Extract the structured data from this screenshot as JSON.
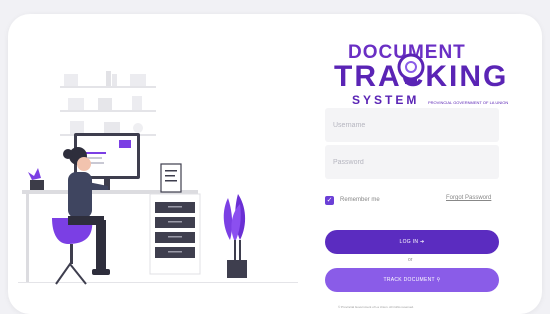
{
  "logo": {
    "line1": "DOCUMENT",
    "line2": "TRACKING",
    "line3": "SYSTEM",
    "tagline": "PROVINCIAL GOVERNMENT OF LA UNION"
  },
  "form": {
    "username_placeholder": "Username",
    "password_placeholder": "Password",
    "remember_label": "Remember me",
    "remember_checked": true,
    "forgot_label": "Forgot Password",
    "login_label": "LOG IN",
    "or_label": "or",
    "track_label": "TRACK DOCUMENT"
  },
  "footer": "© Provincial Government of La Union. All rights reserved.",
  "colors": {
    "primary": "#5b2cc0",
    "secondary": "#8a5ce8",
    "accent_plant": "#7b3fe4"
  }
}
